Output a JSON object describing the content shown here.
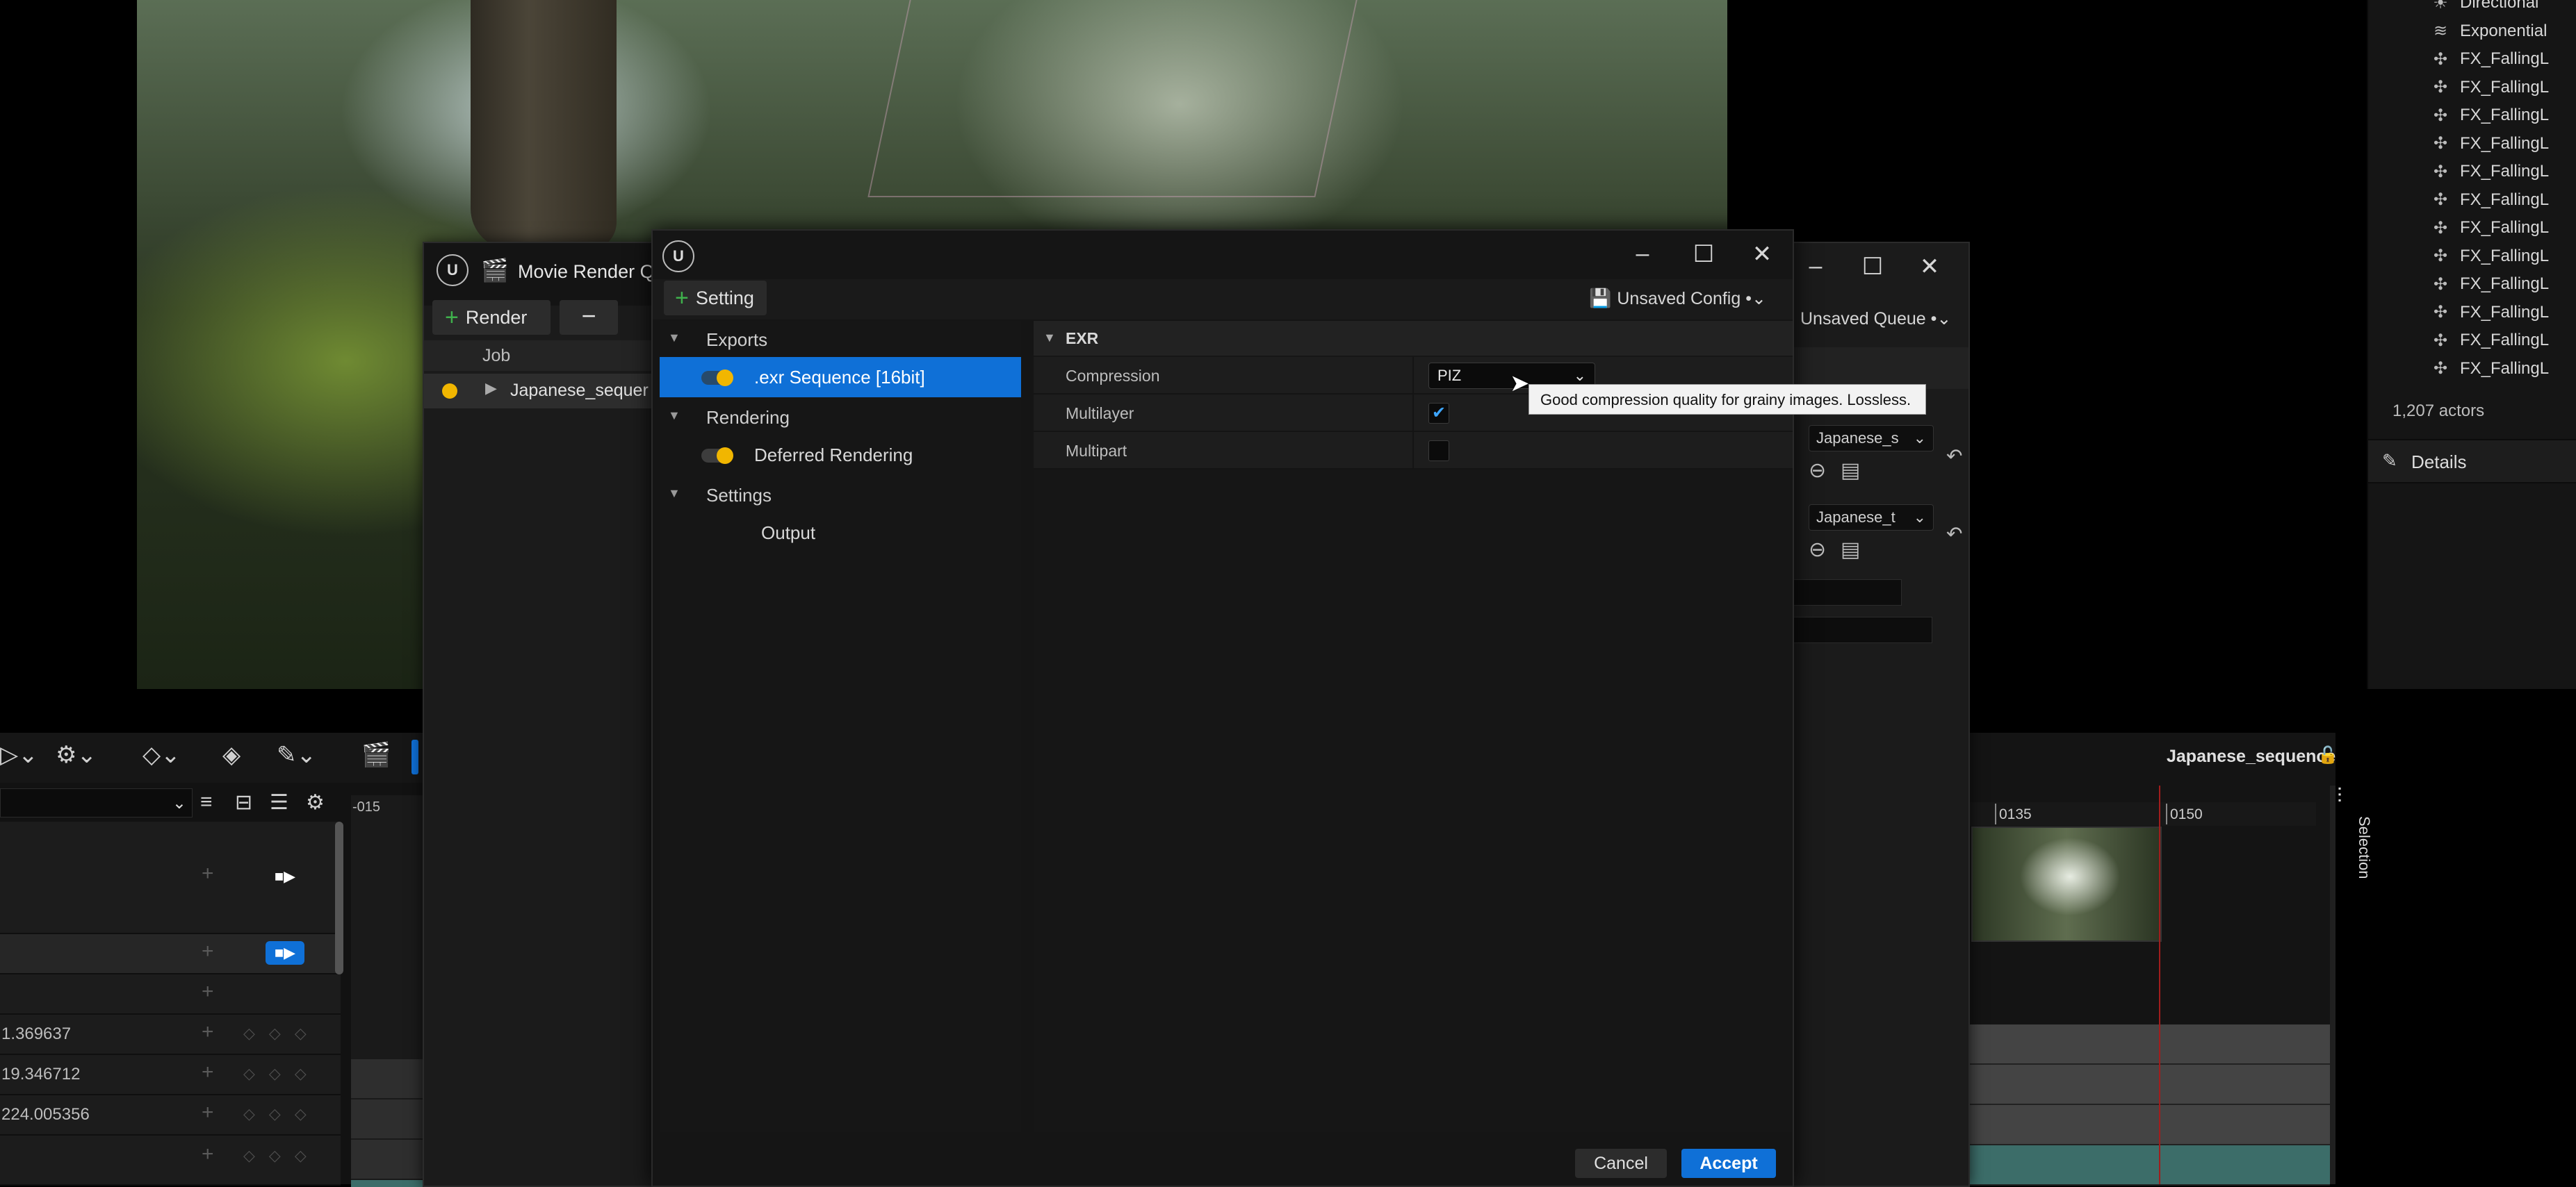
{
  "outliner": {
    "items": [
      {
        "label": "Directional",
        "icon": "light-icon"
      },
      {
        "label": "Exponential",
        "icon": "fog-icon"
      },
      {
        "label": "FX_FallingL",
        "icon": "particle-icon"
      },
      {
        "label": "FX_FallingL",
        "icon": "particle-icon"
      },
      {
        "label": "FX_FallingL",
        "icon": "particle-icon"
      },
      {
        "label": "FX_FallingL",
        "icon": "particle-icon"
      },
      {
        "label": "FX_FallingL",
        "icon": "particle-icon"
      },
      {
        "label": "FX_FallingL",
        "icon": "particle-icon"
      },
      {
        "label": "FX_FallingL",
        "icon": "particle-icon"
      },
      {
        "label": "FX_FallingL",
        "icon": "particle-icon"
      },
      {
        "label": "FX_FallingL",
        "icon": "particle-icon"
      },
      {
        "label": "FX_FallingL",
        "icon": "particle-icon"
      },
      {
        "label": "FX_FallingL",
        "icon": "particle-icon"
      },
      {
        "label": "FX_FallingL",
        "icon": "particle-icon"
      }
    ],
    "actors_count": "1,207 actors",
    "details_label": "Details"
  },
  "mrq": {
    "title": "Movie Render Qu",
    "render_label": "Render",
    "minus_label": "−",
    "job_header": "Job",
    "job_name": "Japanese_sequer",
    "unsaved_queue": "Unsaved Queue",
    "preset_1": "Japanese_s",
    "preset_2": "Japanese_t"
  },
  "dialog": {
    "setting_label": "Setting",
    "unsaved_config": "Unsaved Config",
    "tree": {
      "exports": "Exports",
      "exr_item": ".exr Sequence [16bit]",
      "rendering": "Rendering",
      "deferred_item": "Deferred Rendering",
      "settings": "Settings",
      "output_item": "Output"
    },
    "section_title": "EXR",
    "properties": {
      "compression_label": "Compression",
      "compression_value": "PIZ",
      "multilayer_label": "Multilayer",
      "multilayer_checked": true,
      "multipart_label": "Multipart",
      "multipart_checked": false
    },
    "tooltip": "Good compression quality for grainy images. Lossless.",
    "cancel_label": "Cancel",
    "accept_label": "Accept"
  },
  "sequencer": {
    "sequence_name": "Japanese_sequence",
    "tick_left": "-015",
    "tick_1": "0135",
    "tick_2": "0150",
    "values": [
      "1.369637",
      "19.346712",
      "224.005356"
    ],
    "selection_label": "Selection"
  },
  "colors": {
    "accent": "#0f70d7",
    "toggle_on": "#f1b600",
    "add_green": "#3fb14c",
    "playhead": "#a11d1d"
  }
}
